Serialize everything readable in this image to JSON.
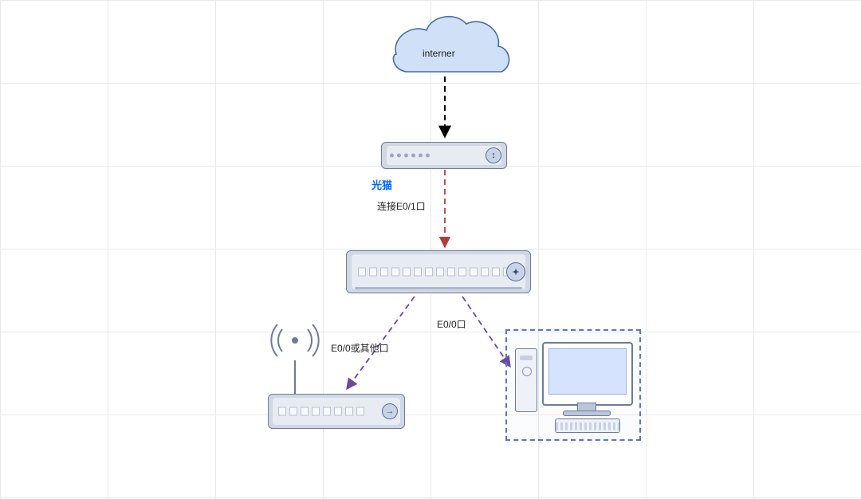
{
  "nodes": {
    "internet": {
      "label": "interner"
    },
    "modem": {
      "label": "光猫"
    },
    "switch": {
      "label": ""
    },
    "ap": {
      "label": ""
    },
    "pc": {
      "label": ""
    }
  },
  "edges": {
    "internet_to_modem": {
      "label": ""
    },
    "modem_to_switch": {
      "label": "连接E0/1口"
    },
    "switch_to_ap": {
      "label": "E0/0或其他口"
    },
    "switch_to_pc": {
      "label": "E0/0口"
    }
  },
  "chart_data": {
    "type": "diagram",
    "title": "",
    "nodes": [
      {
        "id": "internet",
        "type": "cloud",
        "label": "interner"
      },
      {
        "id": "modem",
        "type": "modem",
        "label": "光猫"
      },
      {
        "id": "switch",
        "type": "switch",
        "label": ""
      },
      {
        "id": "ap",
        "type": "wireless-access-point",
        "label": ""
      },
      {
        "id": "pc",
        "type": "pc",
        "label": ""
      }
    ],
    "edges": [
      {
        "from": "internet",
        "to": "modem",
        "label": "",
        "style": "dashed",
        "color": "black"
      },
      {
        "from": "modem",
        "to": "switch",
        "label": "连接E0/1口",
        "style": "dashed",
        "color": "red"
      },
      {
        "from": "switch",
        "to": "ap",
        "label": "E0/0或其他口",
        "style": "dashed",
        "color": "purple"
      },
      {
        "from": "switch",
        "to": "pc",
        "label": "E0/0口",
        "style": "dashed",
        "color": "purple"
      }
    ]
  }
}
